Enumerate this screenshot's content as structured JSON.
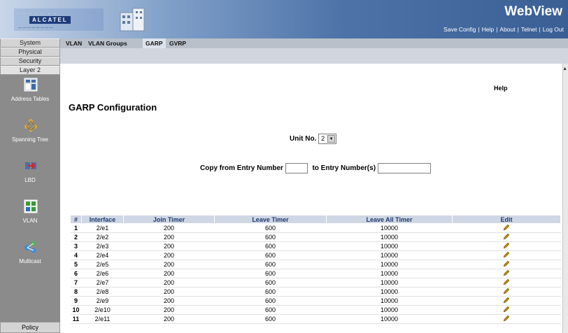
{
  "header": {
    "brand": "WebView",
    "logo_text": "ALCATEL",
    "links": [
      "Save Config",
      "Help",
      "About",
      "Telnet",
      "Log Out"
    ],
    "link_separator": "|"
  },
  "sidebar": {
    "tabs": [
      "System",
      "Physical",
      "Security",
      "Layer 2"
    ],
    "items": [
      {
        "label": "Address Tables",
        "icon": "address-tables-icon"
      },
      {
        "label": "Spanning Tree",
        "icon": "spanning-tree-icon"
      },
      {
        "label": "LBD",
        "icon": "lbd-icon"
      },
      {
        "label": "VLAN",
        "icon": "vlan-icon"
      },
      {
        "label": "Multicast",
        "icon": "multicast-icon"
      }
    ],
    "bottom_tab": "Policy"
  },
  "tabs": [
    {
      "label": "VLAN",
      "active": false
    },
    {
      "label": "VLAN Groups",
      "active": false
    },
    {
      "label": "GARP",
      "active": true
    },
    {
      "label": "GVRP",
      "active": false
    }
  ],
  "page": {
    "help": "Help",
    "title": "GARP Configuration",
    "unit_label": "Unit No.",
    "unit_value": "2",
    "copy_from_label": "Copy from Entry Number",
    "copy_to_label": "to Entry Number(s)"
  },
  "table": {
    "headers": [
      "#",
      "Interface",
      "Join Timer",
      "Leave Timer",
      "Leave All Timer",
      "Edit"
    ],
    "rows": [
      {
        "num": "1",
        "iface": "2/e1",
        "join": "200",
        "leave": "600",
        "leaveall": "10000"
      },
      {
        "num": "2",
        "iface": "2/e2",
        "join": "200",
        "leave": "600",
        "leaveall": "10000"
      },
      {
        "num": "3",
        "iface": "2/e3",
        "join": "200",
        "leave": "600",
        "leaveall": "10000"
      },
      {
        "num": "4",
        "iface": "2/e4",
        "join": "200",
        "leave": "600",
        "leaveall": "10000"
      },
      {
        "num": "5",
        "iface": "2/e5",
        "join": "200",
        "leave": "600",
        "leaveall": "10000"
      },
      {
        "num": "6",
        "iface": "2/e6",
        "join": "200",
        "leave": "600",
        "leaveall": "10000"
      },
      {
        "num": "7",
        "iface": "2/e7",
        "join": "200",
        "leave": "600",
        "leaveall": "10000"
      },
      {
        "num": "8",
        "iface": "2/e8",
        "join": "200",
        "leave": "600",
        "leaveall": "10000"
      },
      {
        "num": "9",
        "iface": "2/e9",
        "join": "200",
        "leave": "600",
        "leaveall": "10000"
      },
      {
        "num": "10",
        "iface": "2/e10",
        "join": "200",
        "leave": "600",
        "leaveall": "10000"
      },
      {
        "num": "11",
        "iface": "2/e11",
        "join": "200",
        "leave": "600",
        "leaveall": "10000"
      }
    ]
  },
  "colors": {
    "header_dark": "#3a5f95",
    "sidebar": "#8b8b8b",
    "table_header": "#cfd6e4",
    "edit_icon": "#b8860b"
  }
}
